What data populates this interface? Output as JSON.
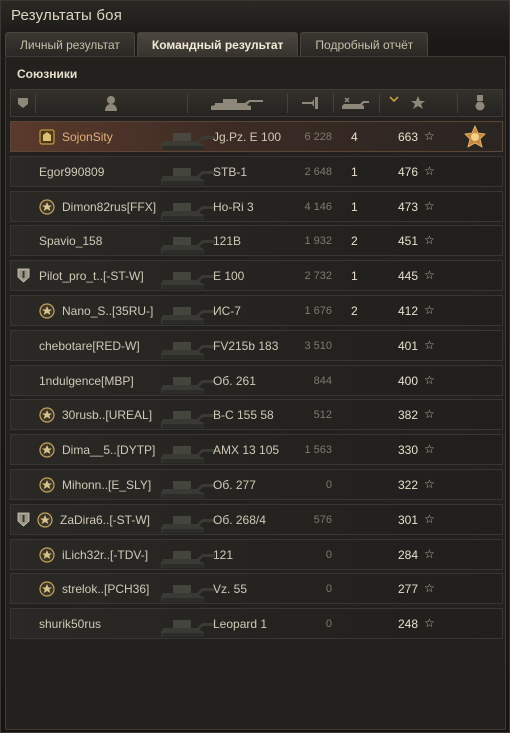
{
  "window": {
    "title": "Результаты боя"
  },
  "tabs": [
    {
      "label": "Личный результат",
      "active": false
    },
    {
      "label": "Командный результат",
      "active": true
    },
    {
      "label": "Подробный отчёт",
      "active": false
    }
  ],
  "section": {
    "title": "Союзники"
  },
  "columns": [
    "platoon-icon",
    "player-icon",
    "tank-icon",
    "damage-icon",
    "kills-icon",
    "experience-star-icon",
    "medal-icon"
  ],
  "sort_indicator": "chevron-down-icon",
  "colors": {
    "highlight_row": "#5a3a2c",
    "player_self": "#e3b07a"
  },
  "players": [
    {
      "player": "SojonSity",
      "tank": "Jg.Pz. E 100",
      "damage": "6 228",
      "kills": "4",
      "xp": "663",
      "clan_badge": "",
      "achievement_badge": "mastery-badge-icon",
      "medal": "medal-icon",
      "highlight": true
    },
    {
      "player": "Egor990809",
      "tank": "STB-1",
      "damage": "2 648",
      "kills": "1",
      "xp": "476",
      "clan_badge": "",
      "achievement_badge": "",
      "medal": "",
      "highlight": false
    },
    {
      "player": "Dimon82rus[FFX]",
      "tank": "Ho-Ri 3",
      "damage": "4 146",
      "kills": "1",
      "xp": "473",
      "clan_badge": "",
      "achievement_badge": "rank-badge-icon",
      "medal": "",
      "highlight": false
    },
    {
      "player": "Spavio_158",
      "tank": "121B",
      "damage": "1 932",
      "kills": "2",
      "xp": "451",
      "clan_badge": "",
      "achievement_badge": "",
      "medal": "",
      "highlight": false
    },
    {
      "player": "Pilot_pro_t..[-ST-W]",
      "tank": "E 100",
      "damage": "2 732",
      "kills": "1",
      "xp": "445",
      "clan_badge": "clan-shield-icon",
      "achievement_badge": "",
      "medal": "",
      "highlight": false
    },
    {
      "player": "Nano_S..[35RU-]",
      "tank": "ИС-7",
      "damage": "1 676",
      "kills": "2",
      "xp": "412",
      "clan_badge": "",
      "achievement_badge": "rank-badge-icon",
      "medal": "",
      "highlight": false
    },
    {
      "player": "chebotare[RED-W]",
      "tank": "FV215b 183",
      "damage": "3 510",
      "kills": "",
      "xp": "401",
      "clan_badge": "",
      "achievement_badge": "",
      "medal": "",
      "highlight": false
    },
    {
      "player": "1ndulgence[MBP]",
      "tank": "Об. 261",
      "damage": "844",
      "kills": "",
      "xp": "400",
      "clan_badge": "",
      "achievement_badge": "",
      "medal": "",
      "highlight": false
    },
    {
      "player": "30rusb..[UREAL]",
      "tank": "B-C 155 58",
      "damage": "512",
      "kills": "",
      "xp": "382",
      "clan_badge": "",
      "achievement_badge": "rank-badge-icon",
      "medal": "",
      "highlight": false
    },
    {
      "player": "Dima__5..[DYTP]",
      "tank": "AMX 13 105",
      "damage": "1 563",
      "kills": "",
      "xp": "330",
      "clan_badge": "",
      "achievement_badge": "rank-badge-icon",
      "medal": "",
      "highlight": false
    },
    {
      "player": "Mihonn..[E_SLY]",
      "tank": "Об. 277",
      "damage": "0",
      "kills": "",
      "xp": "322",
      "clan_badge": "",
      "achievement_badge": "rank-badge-icon",
      "medal": "",
      "highlight": false
    },
    {
      "player": "ZaDira6..[-ST-W]",
      "tank": "Об. 268/4",
      "damage": "576",
      "kills": "",
      "xp": "301",
      "clan_badge": "clan-shield-icon",
      "achievement_badge": "rank-badge-icon",
      "medal": "",
      "highlight": false
    },
    {
      "player": "iLich32r..[-TDV-]",
      "tank": "121",
      "damage": "0",
      "kills": "",
      "xp": "284",
      "clan_badge": "",
      "achievement_badge": "rank-badge-icon",
      "medal": "",
      "highlight": false
    },
    {
      "player": "strelok..[PCH36]",
      "tank": "Vz. 55",
      "damage": "0",
      "kills": "",
      "xp": "277",
      "clan_badge": "",
      "achievement_badge": "rank-badge-icon",
      "medal": "",
      "highlight": false
    },
    {
      "player": "shurik50rus",
      "tank": "Leopard 1",
      "damage": "0",
      "kills": "",
      "xp": "248",
      "clan_badge": "",
      "achievement_badge": "",
      "medal": "",
      "highlight": false
    }
  ]
}
